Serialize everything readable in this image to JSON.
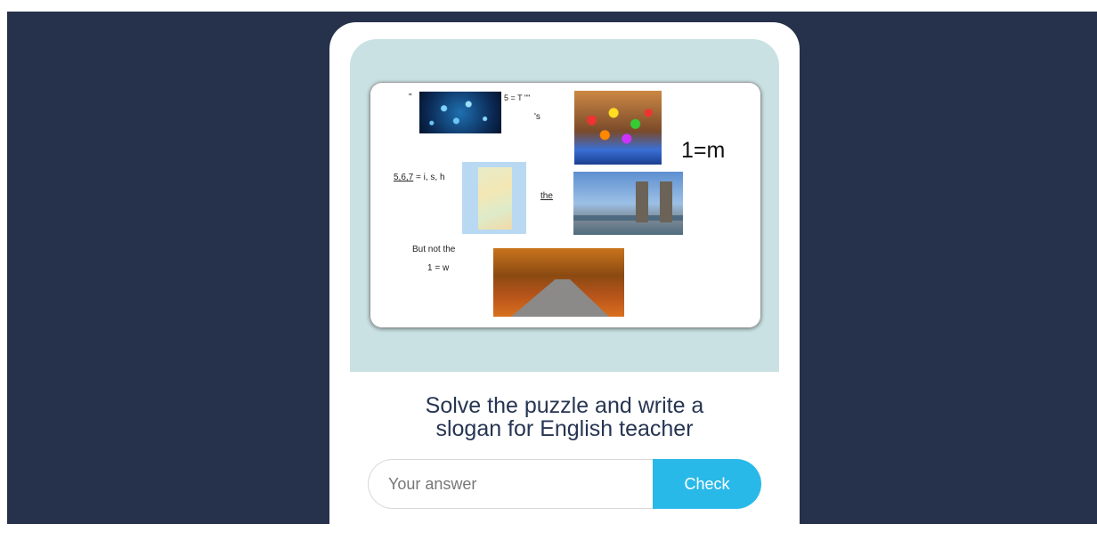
{
  "puzzle": {
    "quote_mark": "\"",
    "molecules_caption": "5 = T \"\"",
    "apostrophe_s": "'s",
    "big_equation": "1=m",
    "map_clue_numbers": "5,6,7",
    "map_clue_letters": " = i, s, h",
    "the_word": "the",
    "but_not_the": "But not the",
    "one_equals_w": "1 = w"
  },
  "prompt": {
    "line1": "Solve the puzzle and write a",
    "line2": "slogan for English teacher"
  },
  "answer": {
    "placeholder": "Your answer",
    "value": "",
    "button_label": "Check"
  },
  "colors": {
    "background": "#26324b",
    "panel": "#c9e1e3",
    "button": "#29b9e8",
    "prompt_text": "#273553"
  }
}
